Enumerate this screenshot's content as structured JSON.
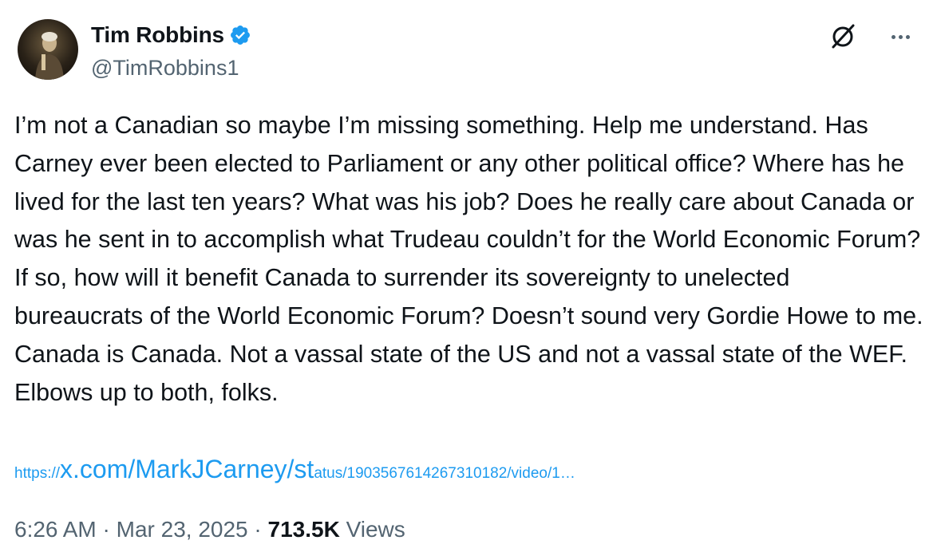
{
  "author": {
    "display_name": "Tim Robbins",
    "handle": "@TimRobbins1",
    "verified": true,
    "verified_color": "#1d9bf0"
  },
  "icons": {
    "avatar": "profile-photo",
    "verified": "verified-badge-icon",
    "grok": "grok-icon",
    "more": "more-options-icon"
  },
  "tweet": {
    "text": "I’m not a Canadian so maybe I’m missing something. Help me understand. Has Carney ever been elected to Parliament or any other political office? Where has he lived for the last ten years? What was his job? Does he really care about Canada or was he sent in to accomplish what Trudeau couldn’t for the World Economic Forum? If so, how will it benefit Canada to surrender its sovereignty to unelected bureaucrats of the World Economic Forum? Doesn’t sound very Gordie Howe to me. Canada is Canada. Not a vassal state of the US and not a vassal state of the WEF. Elbows up to both, folks.",
    "link": {
      "prefix": "https://",
      "main": "x.com/MarkJCarney/st",
      "suffix": "atus/1903567614267310182/video/1…"
    },
    "time": "6:26 AM",
    "separator": "·",
    "date": "Mar 23, 2025",
    "views_count": "713.5K",
    "views_label": "Views"
  },
  "colors": {
    "text": "#0f1419",
    "secondary": "#536471",
    "link": "#1d9bf0"
  }
}
